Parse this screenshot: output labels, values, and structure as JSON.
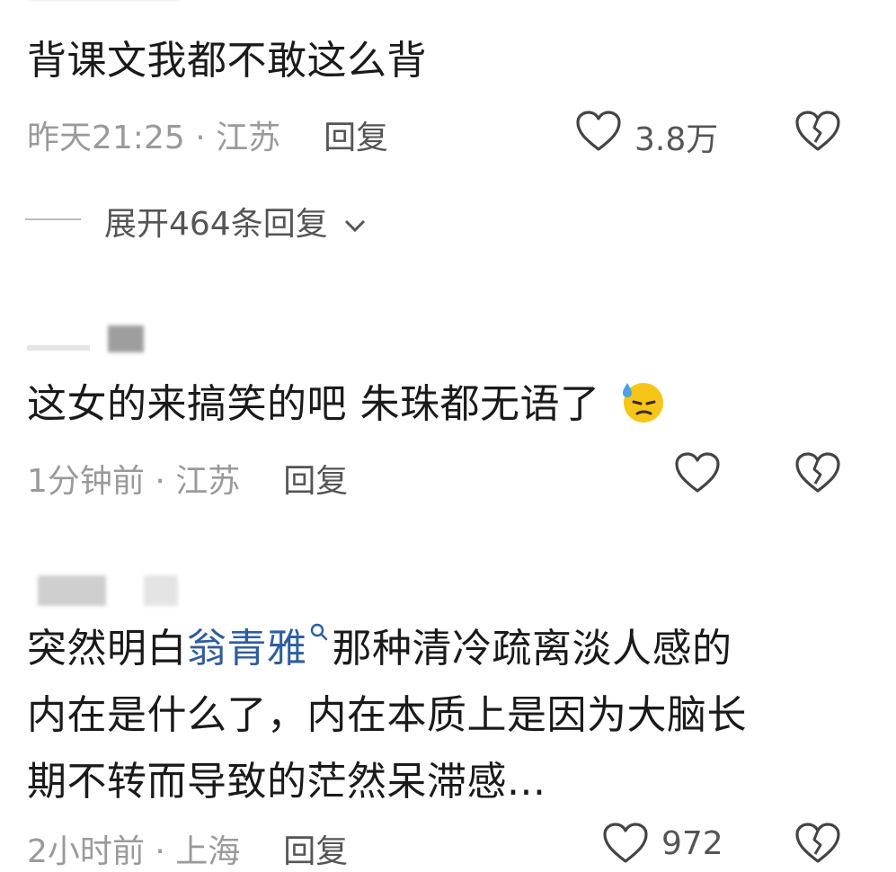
{
  "comments": [
    {
      "text": "背课文我都不敢这么背",
      "time": "昨天21:25 · 江苏",
      "reply_label": "回复",
      "likes": "3.8万"
    },
    {
      "text": "这女的来搞笑的吧 朱珠都无语了",
      "emoji": "😓",
      "time": "1分钟前 · 江苏",
      "reply_label": "回复",
      "likes": ""
    },
    {
      "text_before": "突然明白",
      "link": "翁青雅",
      "text_after_line1": "那种清冷疏离淡人感的",
      "line2": "内在是什么了，内在本质上是因为大脑长",
      "line3": "期不转而导致的茫然呆滞感...",
      "time": "2小时前 · 上海",
      "reply_label": "回复",
      "likes": "972"
    }
  ],
  "expand_replies": "展开464条回复",
  "colors": {
    "link": "#2f5d9e",
    "meta": "#9a9a9a",
    "text": "#1a1a1a"
  },
  "icons": [
    "heart-outline-icon",
    "broken-heart-icon",
    "chevron-down-icon",
    "search-icon"
  ]
}
